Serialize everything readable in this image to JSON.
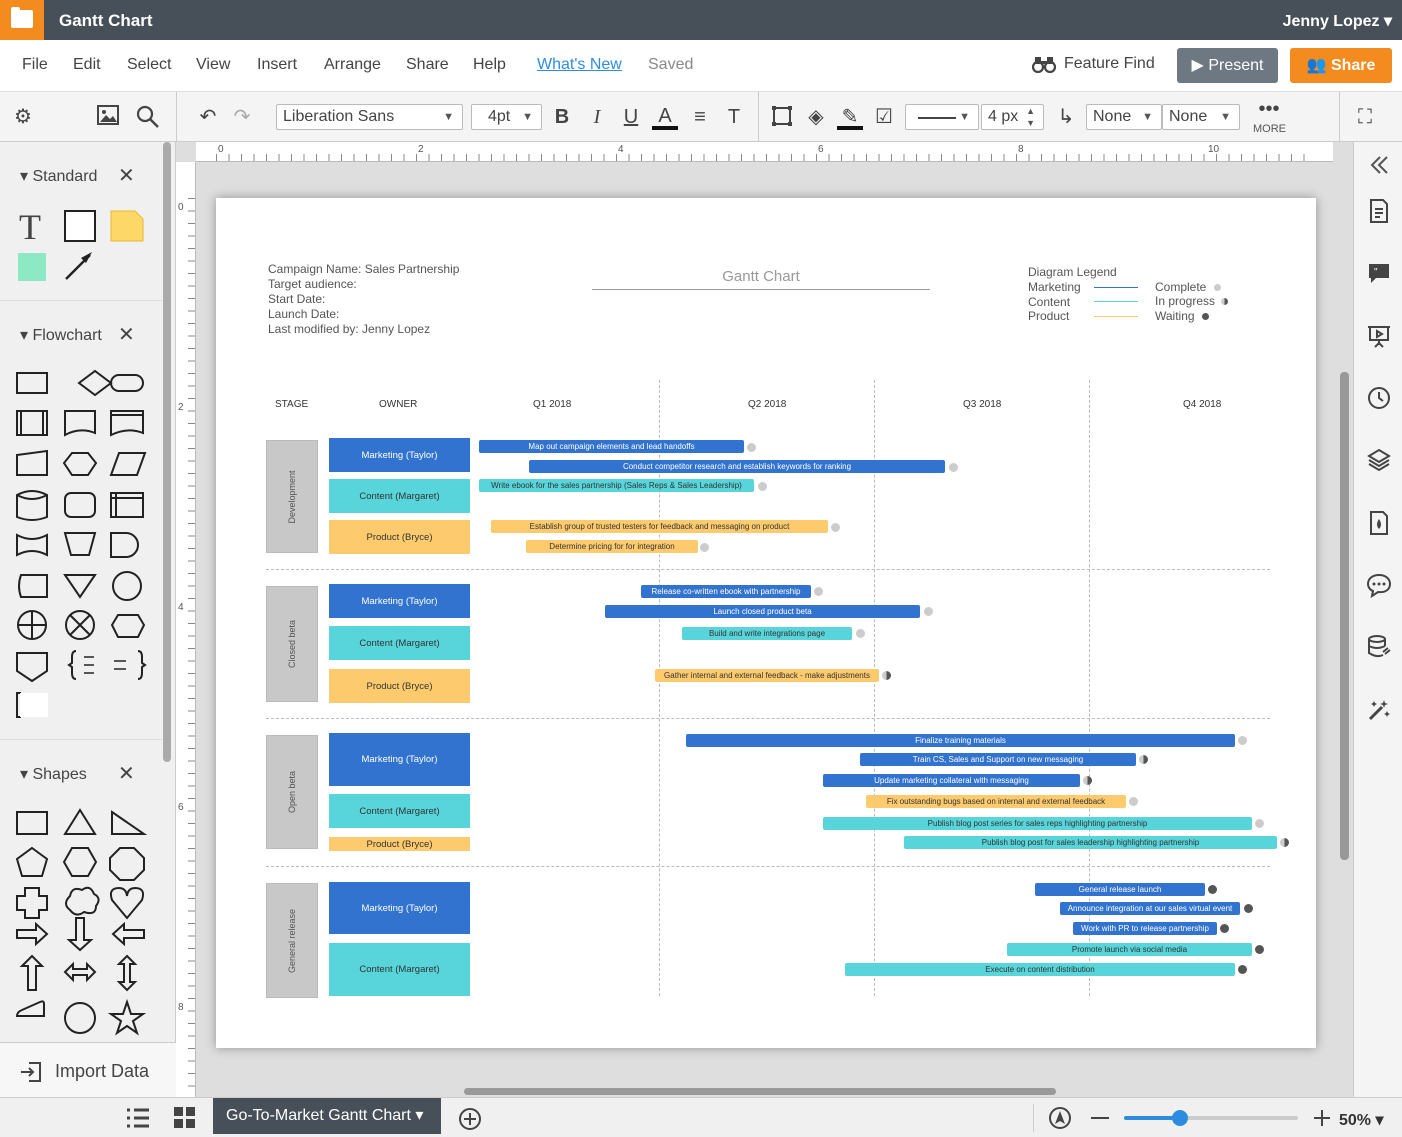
{
  "app": {
    "doc_title": "Gantt Chart",
    "user": "Jenny Lopez ▾"
  },
  "menu": {
    "items": [
      "File",
      "Edit",
      "Select",
      "View",
      "Insert",
      "Arrange",
      "Share",
      "Help"
    ],
    "whats_new": "What's New",
    "saved": "Saved",
    "feature_find": "Feature Find",
    "present": "Present",
    "share": "Share"
  },
  "toolbar": {
    "font": "Liberation Sans",
    "font_size": "4pt",
    "line_width": "4 px",
    "arrow_start": "None",
    "arrow_end": "None",
    "more": "MORE"
  },
  "sidebar": {
    "sections": [
      "Standard",
      "Flowchart",
      "Shapes"
    ],
    "import": "Import Data"
  },
  "rulers": {
    "top": [
      "0",
      "2",
      "4",
      "6",
      "8",
      "10"
    ],
    "left": [
      "0",
      "2",
      "4",
      "6",
      "8"
    ]
  },
  "bottom": {
    "page_tab": "Go-To-Market Gantt Chart",
    "zoom": "50%"
  },
  "colors": {
    "marketing": "#3273d0",
    "content": "#57d5da",
    "product": "#fdcb6e",
    "accent": "#f48b1e"
  },
  "gantt": {
    "title": "Gantt Chart",
    "info": [
      "Campaign Name: Sales Partnership",
      "Target audience:",
      "Start Date:",
      "Launch Date:",
      "Last modified by: Jenny Lopez"
    ],
    "legend": {
      "title": "Diagram Legend",
      "series": [
        "Marketing",
        "Content",
        "Product"
      ],
      "statuses": [
        "Complete",
        "In progress",
        "Waiting"
      ]
    },
    "headers": {
      "stage": "STAGE",
      "owner": "OWNER",
      "quarters": [
        "Q1 2018",
        "Q2 2018",
        "Q3 2018",
        "Q4 2018"
      ]
    },
    "stages": [
      "Development",
      "Closed beta",
      "Open beta",
      "General release"
    ],
    "owners": {
      "marketing": "Marketing (Taylor)",
      "content": "Content (Margaret)",
      "product": "Product (Bryce)"
    },
    "tasks": [
      "Map out campaign elements and lead handoffs",
      "Conduct competitor research and establish keywords for ranking",
      "Write ebook for the sales partnership (Sales Reps & Sales Leadership)",
      "Establish group of trusted testers for feedback and messaging on product",
      "Determine pricing for for integration",
      "Release co-written ebook with partnership",
      "Launch closed product beta",
      "Build and write integrations page",
      "Gather internal and external feedback - make adjustments",
      "Finalize training materials",
      "Train CS, Sales and Support on new messaging",
      "Update marketing collateral with messaging",
      "Fix outstanding bugs based on internal and external feedback",
      "Publish blog post series for sales reps highlighting partnership",
      "Publish blog post for sales leadership highlighting partnership",
      "General release launch",
      "Announce integration at our sales virtual event",
      "Work with PR to release partnership",
      "Promote launch via social media",
      "Execute on content distribution"
    ]
  }
}
